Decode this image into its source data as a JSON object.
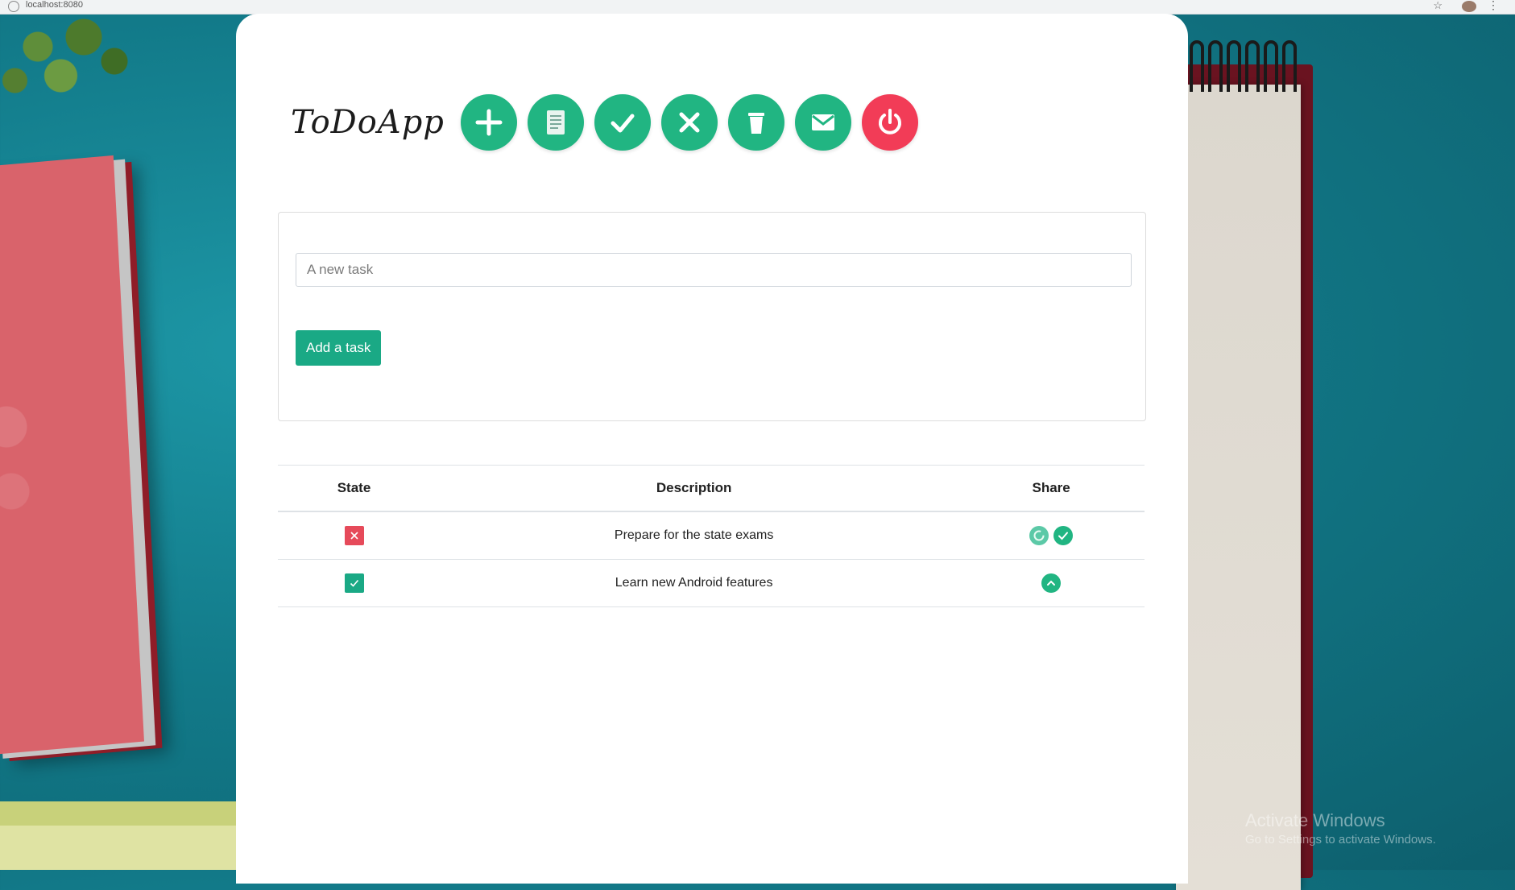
{
  "app": {
    "title": "ToDoApp"
  },
  "browser": {
    "url_text": "localhost:8080"
  },
  "toolbar": {
    "buttons": [
      {
        "name": "add",
        "icon": "plus-icon"
      },
      {
        "name": "list",
        "icon": "document-list-icon"
      },
      {
        "name": "done",
        "icon": "check-icon"
      },
      {
        "name": "undone",
        "icon": "x-icon"
      },
      {
        "name": "delete",
        "icon": "trash-icon"
      },
      {
        "name": "mail",
        "icon": "envelope-icon"
      },
      {
        "name": "logout",
        "icon": "power-icon"
      }
    ]
  },
  "form": {
    "placeholder": "A new task",
    "value": "",
    "add_label": "Add a task"
  },
  "table": {
    "headers": {
      "state": "State",
      "description": "Description",
      "share": "Share"
    },
    "rows": [
      {
        "state": "pending",
        "description": "Prepare for the state exams",
        "share_icons": [
          "refresh-icon",
          "check-circle-icon"
        ]
      },
      {
        "state": "done",
        "description": "Learn new Android features",
        "share_icons": [
          "chevron-up-circle-icon"
        ]
      }
    ]
  },
  "watermark": {
    "title": "Activate Windows",
    "subtitle": "Go to Settings to activate Windows."
  },
  "colors": {
    "accent": "#21b582",
    "danger": "#f23c57",
    "pending_state": "#e64a5a",
    "done_state": "#1aa985"
  }
}
